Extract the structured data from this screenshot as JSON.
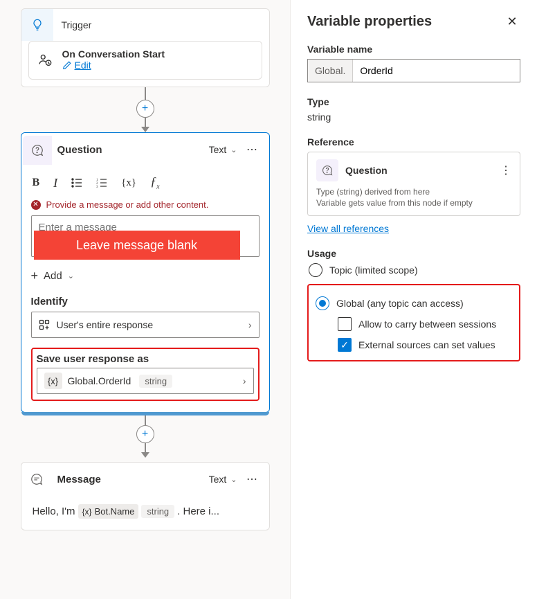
{
  "canvas": {
    "trigger": {
      "title": "Trigger",
      "event": "On Conversation Start",
      "edit": "Edit"
    },
    "question": {
      "title": "Question",
      "outputType": "Text",
      "error": "Provide a message or add other content.",
      "placeholder": "Enter a message",
      "callout": "Leave message blank",
      "addLabel": "Add",
      "identifyLabel": "Identify",
      "identifyValue": "User's entire response",
      "saveLabel": "Save user response as",
      "varName": "Global.OrderId",
      "varType": "string"
    },
    "message": {
      "title": "Message",
      "outputType": "Text",
      "prefix": "Hello, I'm",
      "botVar": "Bot.Name",
      "botVarType": "string",
      "suffix": ". Here i..."
    }
  },
  "panel": {
    "title": "Variable properties",
    "nameLabel": "Variable name",
    "namePrefix": "Global.",
    "nameValue": "OrderId",
    "typeLabel": "Type",
    "typeValue": "string",
    "refLabel": "Reference",
    "refTitle": "Question",
    "refDesc1": "Type (string) derived from here",
    "refDesc2": "Variable gets value from this node if empty",
    "viewAll": "View all references",
    "usageLabel": "Usage",
    "topicOption": "Topic (limited scope)",
    "globalOption": "Global (any topic can access)",
    "carryOption": "Allow to carry between sessions",
    "externalOption": "External sources can set values"
  }
}
